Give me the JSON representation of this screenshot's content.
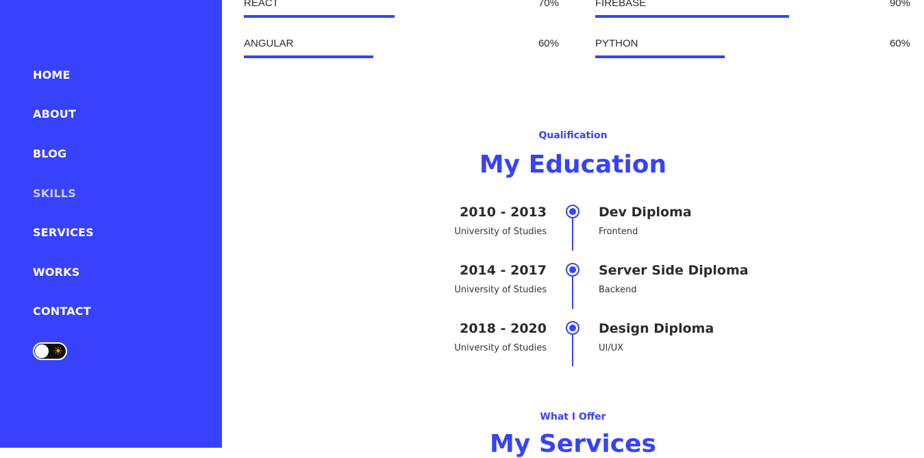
{
  "theme": {
    "accent": "#3742fa"
  },
  "nav": {
    "items": [
      {
        "label": "HOME"
      },
      {
        "label": "ABOUT"
      },
      {
        "label": "BLOG"
      },
      {
        "label": "SKILLS"
      },
      {
        "label": "SERVICES"
      },
      {
        "label": "WORKS"
      },
      {
        "label": "CONTACT"
      }
    ],
    "active": "SKILLS",
    "theme_toggle_icon": "sun-icon"
  },
  "skills": [
    {
      "name": "REACT",
      "percent_label": "70%",
      "level": 0.7
    },
    {
      "name": "FIREBASE",
      "percent_label": "90%",
      "level": 0.9
    },
    {
      "name": "ANGULAR",
      "percent_label": "60%",
      "level": 0.6
    },
    {
      "name": "PYTHON",
      "percent_label": "60%",
      "level": 0.6
    }
  ],
  "education": {
    "kicker": "Qualification",
    "title": "My Education",
    "entries": [
      {
        "years": "2010 - 2013",
        "school": "University of Studies",
        "degree": "Dev Diploma",
        "field": "Frontend"
      },
      {
        "years": "2014 - 2017",
        "school": "University of Studies",
        "degree": "Server Side Diploma",
        "field": "Backend"
      },
      {
        "years": "2018 - 2020",
        "school": "University of Studies",
        "degree": "Design Diploma",
        "field": "UI/UX"
      }
    ]
  },
  "services": {
    "kicker": "What I Offer",
    "title": "My Services"
  }
}
